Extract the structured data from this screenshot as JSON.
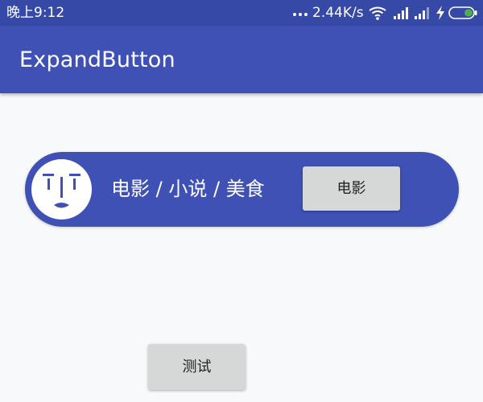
{
  "status_bar": {
    "time": "晚上9:12",
    "network_speed": "2.44K/s"
  },
  "toolbar": {
    "title": "ExpandButton"
  },
  "expand_button": {
    "icon": "face-icon",
    "label": "电影 / 小说 / 美食",
    "selected_label": "电影"
  },
  "test_button": {
    "label": "测试"
  },
  "colors": {
    "primary": "#3f51b5",
    "status_bar": "#3649a6",
    "background": "#f8f9fa",
    "button": "#d6d7d7",
    "battery_level": "#4caf50"
  }
}
